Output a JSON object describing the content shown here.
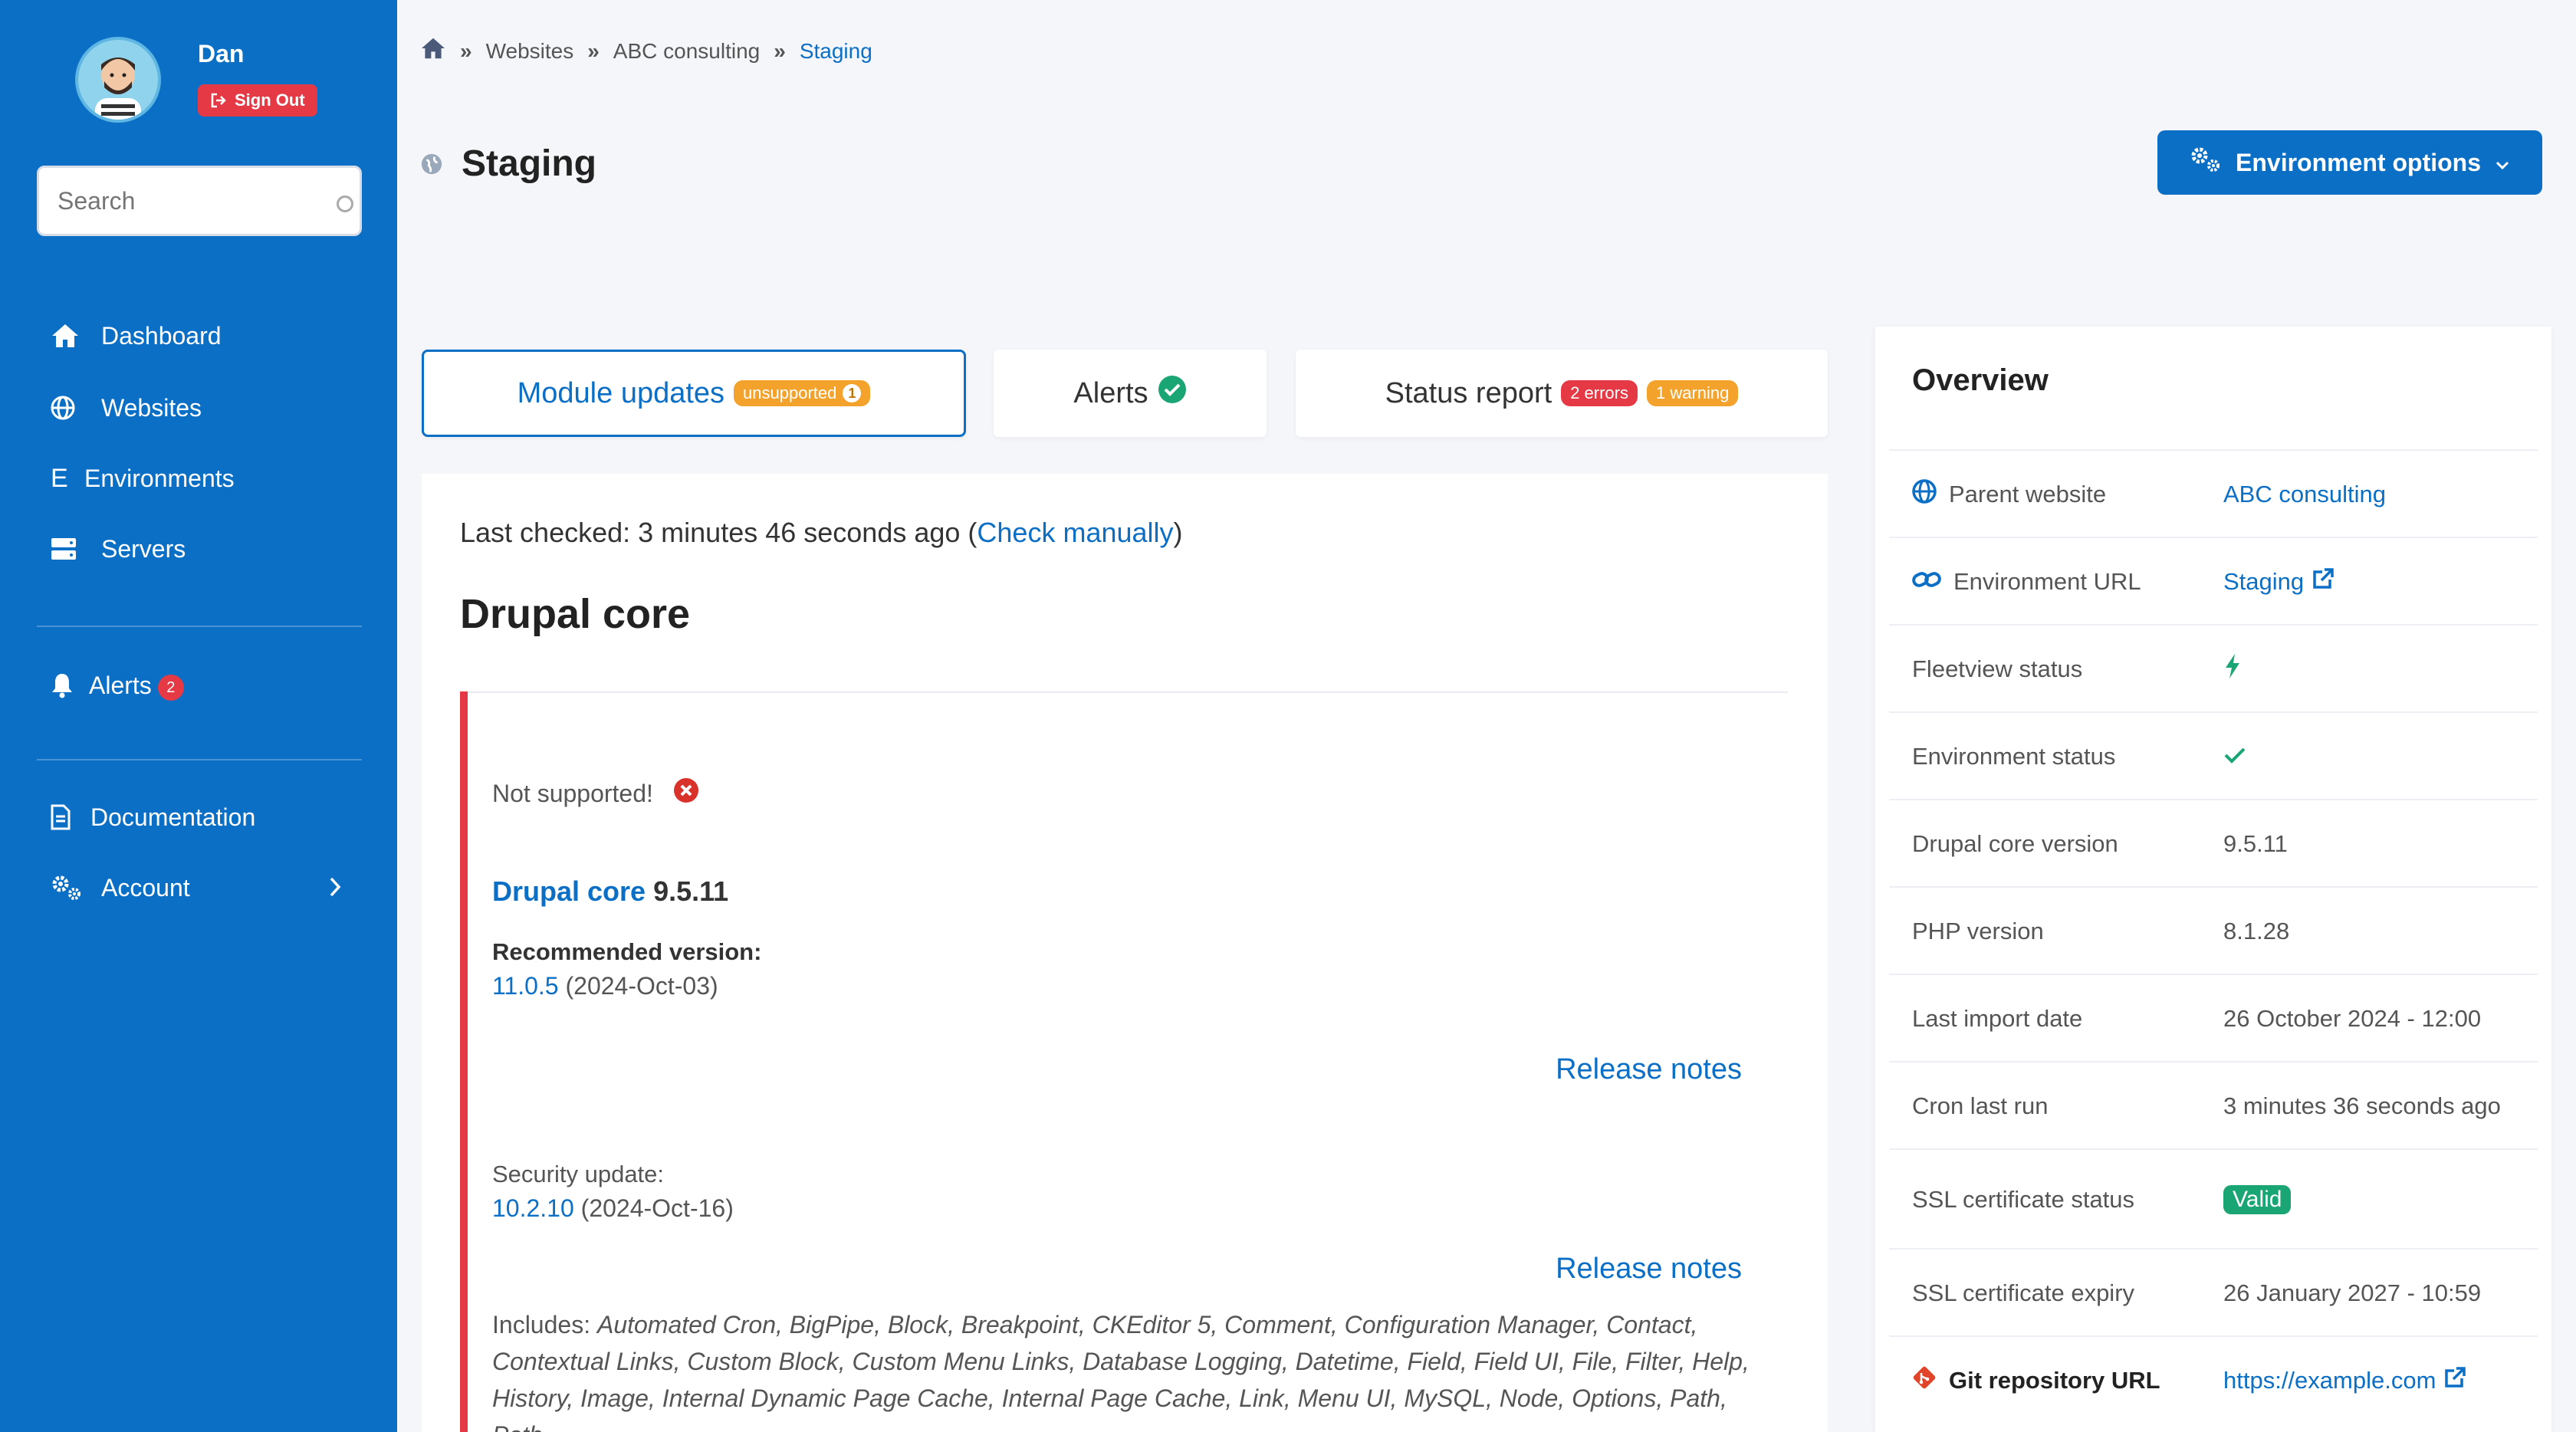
{
  "user": {
    "name": "Dan",
    "sign_out": "Sign Out"
  },
  "search": {
    "placeholder": "Search"
  },
  "nav": {
    "dashboard": "Dashboard",
    "websites": "Websites",
    "environments": "Environments",
    "environments_letter": "E",
    "servers": "Servers",
    "alerts": "Alerts",
    "alerts_count": "2",
    "documentation": "Documentation",
    "account": "Account"
  },
  "breadcrumb": {
    "item1": "Websites",
    "item2": "ABC consulting",
    "item3": "Staging"
  },
  "page": {
    "title": "Staging",
    "env_options": "Environment options"
  },
  "tabs": {
    "module_updates": "Module updates",
    "module_badge": "unsupported",
    "module_badge_count": "1",
    "alerts": "Alerts",
    "status_report": "Status report",
    "errors_badge": "2 errors",
    "warning_badge": "1 warning"
  },
  "main": {
    "last_checked_prefix": "Last checked: 3 minutes 46 seconds ago (",
    "check_manually": "Check manually",
    "last_checked_suffix": ")",
    "section_title": "Drupal core",
    "not_supported": "Not supported!",
    "core_link": "Drupal core",
    "core_version": "9.5.11",
    "recommended_label": "Recommended version:",
    "recommended_version": "11.0.5",
    "recommended_date": "(2024-Oct-03)",
    "release_notes_1": "Release notes",
    "security_label": "Security update:",
    "security_version": "10.2.10",
    "security_date": "(2024-Oct-16)",
    "release_notes_2": "Release notes",
    "includes_label": "Includes:",
    "includes_list": "Automated Cron, BigPipe, Block, Breakpoint, CKEditor 5, Comment, Configuration Manager, Contact, Contextual Links, Custom Block, Custom Menu Links, Database Logging, Datetime, Field, Field UI, File, Filter, Help, History, Image, Internal Dynamic Page Cache, Internal Page Cache, Link, Menu UI, MySQL, Node, Options, Path, Path"
  },
  "overview": {
    "title": "Overview",
    "rows": [
      {
        "label": "Parent website",
        "value": "ABC consulting"
      },
      {
        "label": "Environment URL",
        "value": "Staging"
      },
      {
        "label": "Fleetview status",
        "value": ""
      },
      {
        "label": "Environment status",
        "value": ""
      },
      {
        "label": "Drupal core version",
        "value": "9.5.11"
      },
      {
        "label": "PHP version",
        "value": "8.1.28"
      },
      {
        "label": "Last import date",
        "value": "26 October 2024 - 12:00"
      },
      {
        "label": "Cron last run",
        "value": "3 minutes 36 seconds ago"
      },
      {
        "label": "SSL certificate status",
        "value": "Valid"
      },
      {
        "label": "SSL certificate expiry",
        "value": "26 January 2027 - 10:59"
      },
      {
        "label": "Git repository URL",
        "value": "https://example.com"
      }
    ]
  },
  "colors": {
    "primary": "#0c6fc6",
    "danger": "#e53946",
    "warning": "#f3a32b",
    "success": "#1aa574"
  }
}
